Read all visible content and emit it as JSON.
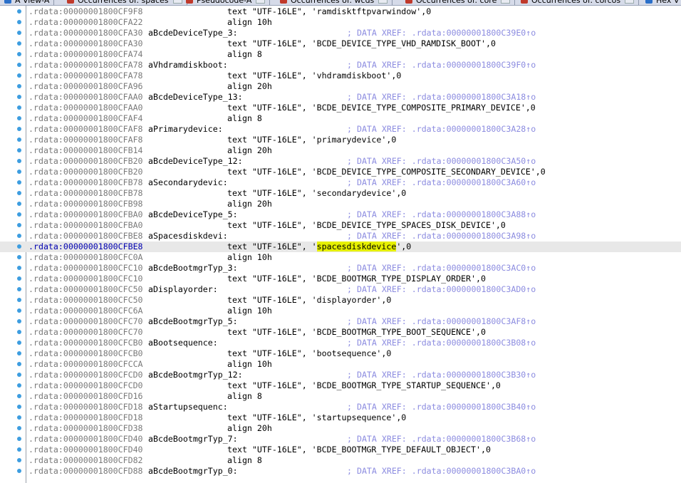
{
  "tabs": [
    {
      "label": "A View-A",
      "icon": "view-icon"
    },
    {
      "label": "Occurrences of: spaces",
      "icon": "occurrences-icon"
    },
    {
      "label": "Pseudocode-A",
      "icon": "pseudocode-icon"
    },
    {
      "label": "Occurrences of: wcds",
      "icon": "occurrences-icon"
    },
    {
      "label": "Occurrences of: core",
      "icon": "occurrences-icon"
    },
    {
      "label": "Occurrences of: corcos",
      "icon": "occurrences-icon"
    },
    {
      "label": "Hex V",
      "icon": "hex-icon"
    }
  ],
  "listing": [
    {
      "addr": ".rdata:00000001800CF9F8",
      "label": "",
      "instr": "text \"UTF-16LE\", 'ramdisktftpvarwindow',0",
      "comment": ""
    },
    {
      "addr": ".rdata:00000001800CFA22",
      "label": "",
      "instr": "align 10h",
      "comment": ""
    },
    {
      "addr": ".rdata:00000001800CFA30",
      "label": "aBcdeDeviceType_3:",
      "instr": "",
      "comment": "; DATA XREF: .rdata:00000001800C39E0↑o"
    },
    {
      "addr": ".rdata:00000001800CFA30",
      "label": "",
      "instr": "text \"UTF-16LE\", 'BCDE_DEVICE_TYPE_VHD_RAMDISK_BOOT',0",
      "comment": ""
    },
    {
      "addr": ".rdata:00000001800CFA74",
      "label": "",
      "instr": "align 8",
      "comment": ""
    },
    {
      "addr": ".rdata:00000001800CFA78",
      "label": "aVhdramdiskboot:",
      "instr": "",
      "comment": "; DATA XREF: .rdata:00000001800C39F0↑o"
    },
    {
      "addr": ".rdata:00000001800CFA78",
      "label": "",
      "instr": "text \"UTF-16LE\", 'vhdramdiskboot',0",
      "comment": ""
    },
    {
      "addr": ".rdata:00000001800CFA96",
      "label": "",
      "instr": "align 20h",
      "comment": ""
    },
    {
      "addr": ".rdata:00000001800CFAA0",
      "label": "aBcdeDeviceType_13:",
      "instr": "",
      "comment": "; DATA XREF: .rdata:00000001800C3A18↑o"
    },
    {
      "addr": ".rdata:00000001800CFAA0",
      "label": "",
      "instr": "text \"UTF-16LE\", 'BCDE_DEVICE_TYPE_COMPOSITE_PRIMARY_DEVICE',0",
      "comment": ""
    },
    {
      "addr": ".rdata:00000001800CFAF4",
      "label": "",
      "instr": "align 8",
      "comment": ""
    },
    {
      "addr": ".rdata:00000001800CFAF8",
      "label": "aPrimarydevice:",
      "instr": "",
      "comment": "; DATA XREF: .rdata:00000001800C3A28↑o"
    },
    {
      "addr": ".rdata:00000001800CFAF8",
      "label": "",
      "instr": "text \"UTF-16LE\", 'primarydevice',0",
      "comment": ""
    },
    {
      "addr": ".rdata:00000001800CFB14",
      "label": "",
      "instr": "align 20h",
      "comment": ""
    },
    {
      "addr": ".rdata:00000001800CFB20",
      "label": "aBcdeDeviceType_12:",
      "instr": "",
      "comment": "; DATA XREF: .rdata:00000001800C3A50↑o"
    },
    {
      "addr": ".rdata:00000001800CFB20",
      "label": "",
      "instr": "text \"UTF-16LE\", 'BCDE_DEVICE_TYPE_COMPOSITE_SECONDARY_DEVICE',0",
      "comment": ""
    },
    {
      "addr": ".rdata:00000001800CFB78",
      "label": "aSecondarydevic:",
      "instr": "",
      "comment": "; DATA XREF: .rdata:00000001800C3A60↑o"
    },
    {
      "addr": ".rdata:00000001800CFB78",
      "label": "",
      "instr": "text \"UTF-16LE\", 'secondarydevice',0",
      "comment": ""
    },
    {
      "addr": ".rdata:00000001800CFB98",
      "label": "",
      "instr": "align 20h",
      "comment": ""
    },
    {
      "addr": ".rdata:00000001800CFBA0",
      "label": "aBcdeDeviceType_5:",
      "instr": "",
      "comment": "; DATA XREF: .rdata:00000001800C3A88↑o"
    },
    {
      "addr": ".rdata:00000001800CFBA0",
      "label": "",
      "instr": "text \"UTF-16LE\", 'BCDE_DEVICE_TYPE_SPACES_DISK_DEVICE',0",
      "comment": ""
    },
    {
      "addr": ".rdata:00000001800CFBE8",
      "label": "aSpacesdiskdevi:",
      "instr": "",
      "comment": "; DATA XREF: .rdata:00000001800C3A98↑o"
    },
    {
      "addr": ".rdata:00000001800CFBE8",
      "label": "",
      "instr": "text \"UTF-16LE\", '",
      "hl": "spacesdiskdevice",
      "after": "',0",
      "comment": "",
      "current": true
    },
    {
      "addr": ".rdata:00000001800CFC0A",
      "label": "",
      "instr": "align 10h",
      "comment": ""
    },
    {
      "addr": ".rdata:00000001800CFC10",
      "label": "aBcdeBootmgrTyp_3:",
      "instr": "",
      "comment": "; DATA XREF: .rdata:00000001800C3AC0↑o"
    },
    {
      "addr": ".rdata:00000001800CFC10",
      "label": "",
      "instr": "text \"UTF-16LE\", 'BCDE_BOOTMGR_TYPE_DISPLAY_ORDER',0",
      "comment": ""
    },
    {
      "addr": ".rdata:00000001800CFC50",
      "label": "aDisplayorder:",
      "instr": "",
      "comment": "; DATA XREF: .rdata:00000001800C3AD0↑o"
    },
    {
      "addr": ".rdata:00000001800CFC50",
      "label": "",
      "instr": "text \"UTF-16LE\", 'displayorder',0",
      "comment": ""
    },
    {
      "addr": ".rdata:00000001800CFC6A",
      "label": "",
      "instr": "align 10h",
      "comment": ""
    },
    {
      "addr": ".rdata:00000001800CFC70",
      "label": "aBcdeBootmgrTyp_5:",
      "instr": "",
      "comment": "; DATA XREF: .rdata:00000001800C3AF8↑o"
    },
    {
      "addr": ".rdata:00000001800CFC70",
      "label": "",
      "instr": "text \"UTF-16LE\", 'BCDE_BOOTMGR_TYPE_BOOT_SEQUENCE',0",
      "comment": ""
    },
    {
      "addr": ".rdata:00000001800CFCB0",
      "label": "aBootsequence:",
      "instr": "",
      "comment": "; DATA XREF: .rdata:00000001800C3B08↑o"
    },
    {
      "addr": ".rdata:00000001800CFCB0",
      "label": "",
      "instr": "text \"UTF-16LE\", 'bootsequence',0",
      "comment": ""
    },
    {
      "addr": ".rdata:00000001800CFCCA",
      "label": "",
      "instr": "align 10h",
      "comment": ""
    },
    {
      "addr": ".rdata:00000001800CFCD0",
      "label": "aBcdeBootmgrTyp_12:",
      "instr": "",
      "comment": "; DATA XREF: .rdata:00000001800C3B30↑o"
    },
    {
      "addr": ".rdata:00000001800CFCD0",
      "label": "",
      "instr": "text \"UTF-16LE\", 'BCDE_BOOTMGR_TYPE_STARTUP_SEQUENCE',0",
      "comment": ""
    },
    {
      "addr": ".rdata:00000001800CFD16",
      "label": "",
      "instr": "align 8",
      "comment": ""
    },
    {
      "addr": ".rdata:00000001800CFD18",
      "label": "aStartupsequenc:",
      "instr": "",
      "comment": "; DATA XREF: .rdata:00000001800C3B40↑o"
    },
    {
      "addr": ".rdata:00000001800CFD18",
      "label": "",
      "instr": "text \"UTF-16LE\", 'startupsequence',0",
      "comment": ""
    },
    {
      "addr": ".rdata:00000001800CFD38",
      "label": "",
      "instr": "align 20h",
      "comment": ""
    },
    {
      "addr": ".rdata:00000001800CFD40",
      "label": "aBcdeBootmgrTyp_7:",
      "instr": "",
      "comment": "; DATA XREF: .rdata:00000001800C3B68↑o"
    },
    {
      "addr": ".rdata:00000001800CFD40",
      "label": "",
      "instr": "text \"UTF-16LE\", 'BCDE_BOOTMGR_TYPE_DEFAULT_OBJECT',0",
      "comment": ""
    },
    {
      "addr": ".rdata:00000001800CFD82",
      "label": "",
      "instr": "align 8",
      "comment": ""
    },
    {
      "addr": ".rdata:00000001800CFD88",
      "label": "aBcdeBootmgrTyp_0:",
      "instr": "",
      "comment": "; DATA XREF: .rdata:00000001800C3BA0↑o"
    }
  ],
  "colors": {
    "address": "#7a7a7a",
    "current_address": "#0000b0",
    "comment": "#8c8ce0",
    "highlight": "#e6f000",
    "breakpoint_dot": "#3d9de0",
    "current_line_bg": "#e8e8e8"
  }
}
